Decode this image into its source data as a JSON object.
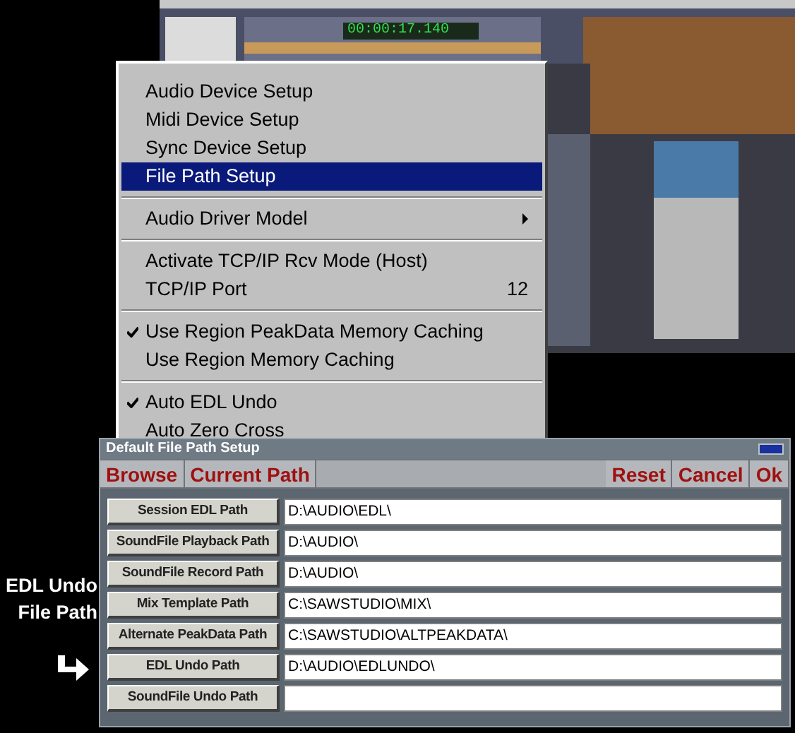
{
  "app_window": {
    "timer": "00:00:17.140"
  },
  "menu": {
    "groups": [
      {
        "items": [
          {
            "label": "Audio Device Setup",
            "selected": false,
            "checked": false,
            "submenu": false
          },
          {
            "label": "Midi Device Setup",
            "selected": false,
            "checked": false,
            "submenu": false
          },
          {
            "label": "Sync Device Setup",
            "selected": false,
            "checked": false,
            "submenu": false
          },
          {
            "label": "File Path Setup",
            "selected": true,
            "checked": false,
            "submenu": false
          }
        ]
      },
      {
        "items": [
          {
            "label": "Audio Driver Model",
            "selected": false,
            "checked": false,
            "submenu": true
          }
        ]
      },
      {
        "items": [
          {
            "label": "Activate TCP/IP Rcv Mode (Host)",
            "selected": false,
            "checked": false,
            "submenu": false
          },
          {
            "label": "TCP/IP Port",
            "value": "12",
            "selected": false,
            "checked": false,
            "submenu": false
          }
        ]
      },
      {
        "items": [
          {
            "label": "Use Region PeakData Memory Caching",
            "selected": false,
            "checked": true,
            "submenu": false
          },
          {
            "label": "Use Region Memory Caching",
            "selected": false,
            "checked": false,
            "submenu": false
          }
        ]
      },
      {
        "items": [
          {
            "label": "Auto EDL Undo",
            "selected": false,
            "checked": true,
            "submenu": false
          },
          {
            "label": "Auto Zero Cross",
            "selected": false,
            "checked": false,
            "submenu": false
          }
        ]
      }
    ]
  },
  "dialog": {
    "title": "Default File Path Setup",
    "toolbar_left": [
      "Browse",
      "Current Path"
    ],
    "toolbar_right": [
      "Reset",
      "Cancel",
      "Ok"
    ],
    "paths": [
      {
        "label": "Session EDL Path",
        "value": "D:\\AUDIO\\EDL\\"
      },
      {
        "label": "SoundFile Playback Path",
        "value": "D:\\AUDIO\\"
      },
      {
        "label": "SoundFile Record Path",
        "value": "D:\\AUDIO\\"
      },
      {
        "label": "Mix Template Path",
        "value": "C:\\SAWSTUDIO\\MIX\\"
      },
      {
        "label": "Alternate PeakData Path",
        "value": "C:\\SAWSTUDIO\\ALTPEAKDATA\\"
      },
      {
        "label": "EDL Undo Path",
        "value": "D:\\AUDIO\\EDLUNDO\\"
      },
      {
        "label": "SoundFile Undo Path"
      }
    ]
  },
  "annotation": {
    "text": "EDL Undo File Path"
  }
}
